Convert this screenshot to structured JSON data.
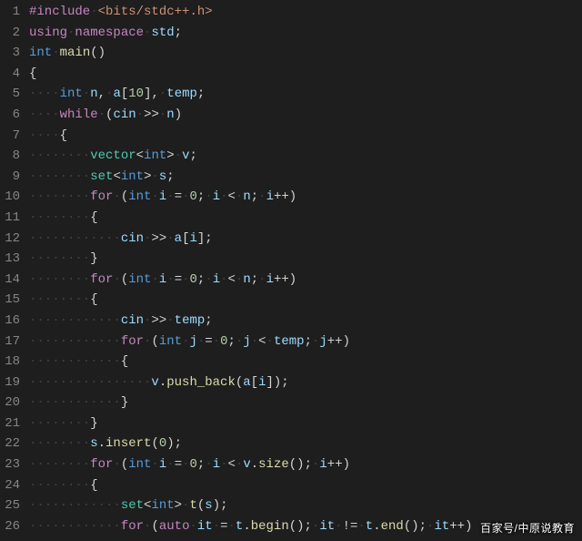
{
  "editor": {
    "line_count": 26,
    "whitespace_glyph": "·",
    "lines": [
      {
        "n": 1,
        "tokens": [
          [
            "pre",
            "#include"
          ],
          [
            "ws",
            "·"
          ],
          [
            "str",
            "<bits/stdc++.h>"
          ]
        ]
      },
      {
        "n": 2,
        "tokens": [
          [
            "kw",
            "using"
          ],
          [
            "ws",
            "·"
          ],
          [
            "kw",
            "namespace"
          ],
          [
            "ws",
            "·"
          ],
          [
            "id",
            "std"
          ],
          [
            "pun",
            ";"
          ]
        ]
      },
      {
        "n": 3,
        "tokens": [
          [
            "type",
            "int"
          ],
          [
            "ws",
            "·"
          ],
          [
            "fn",
            "main"
          ],
          [
            "pun",
            "()"
          ]
        ]
      },
      {
        "n": 4,
        "tokens": [
          [
            "pun",
            "{"
          ]
        ]
      },
      {
        "n": 5,
        "tokens": [
          [
            "ws",
            "····"
          ],
          [
            "type",
            "int"
          ],
          [
            "ws",
            "·"
          ],
          [
            "id",
            "n"
          ],
          [
            "pun",
            ","
          ],
          [
            "ws",
            "·"
          ],
          [
            "id",
            "a"
          ],
          [
            "pun",
            "["
          ],
          [
            "num",
            "10"
          ],
          [
            "pun",
            "],"
          ],
          [
            "ws",
            "·"
          ],
          [
            "id",
            "temp"
          ],
          [
            "pun",
            ";"
          ]
        ]
      },
      {
        "n": 6,
        "tokens": [
          [
            "ws",
            "····"
          ],
          [
            "kw",
            "while"
          ],
          [
            "ws",
            "·"
          ],
          [
            "pun",
            "("
          ],
          [
            "id",
            "cin"
          ],
          [
            "ws",
            "·"
          ],
          [
            "op",
            ">>"
          ],
          [
            "ws",
            "·"
          ],
          [
            "id",
            "n"
          ],
          [
            "pun",
            ")"
          ]
        ]
      },
      {
        "n": 7,
        "tokens": [
          [
            "ws",
            "····"
          ],
          [
            "pun",
            "{"
          ]
        ]
      },
      {
        "n": 8,
        "tokens": [
          [
            "ws",
            "········"
          ],
          [
            "cls",
            "vector"
          ],
          [
            "pun",
            "<"
          ],
          [
            "type",
            "int"
          ],
          [
            "pun",
            ">"
          ],
          [
            "ws",
            "·"
          ],
          [
            "id",
            "v"
          ],
          [
            "pun",
            ";"
          ]
        ]
      },
      {
        "n": 9,
        "tokens": [
          [
            "ws",
            "········"
          ],
          [
            "cls",
            "set"
          ],
          [
            "pun",
            "<"
          ],
          [
            "type",
            "int"
          ],
          [
            "pun",
            ">"
          ],
          [
            "ws",
            "·"
          ],
          [
            "id",
            "s"
          ],
          [
            "pun",
            ";"
          ]
        ]
      },
      {
        "n": 10,
        "tokens": [
          [
            "ws",
            "········"
          ],
          [
            "kw",
            "for"
          ],
          [
            "ws",
            "·"
          ],
          [
            "pun",
            "("
          ],
          [
            "type",
            "int"
          ],
          [
            "ws",
            "·"
          ],
          [
            "id",
            "i"
          ],
          [
            "ws",
            "·"
          ],
          [
            "op",
            "="
          ],
          [
            "ws",
            "·"
          ],
          [
            "num",
            "0"
          ],
          [
            "pun",
            ";"
          ],
          [
            "ws",
            "·"
          ],
          [
            "id",
            "i"
          ],
          [
            "ws",
            "·"
          ],
          [
            "op",
            "<"
          ],
          [
            "ws",
            "·"
          ],
          [
            "id",
            "n"
          ],
          [
            "pun",
            ";"
          ],
          [
            "ws",
            "·"
          ],
          [
            "id",
            "i"
          ],
          [
            "op",
            "++"
          ],
          [
            "pun",
            ")"
          ]
        ]
      },
      {
        "n": 11,
        "tokens": [
          [
            "ws",
            "········"
          ],
          [
            "pun",
            "{"
          ]
        ]
      },
      {
        "n": 12,
        "tokens": [
          [
            "ws",
            "············"
          ],
          [
            "id",
            "cin"
          ],
          [
            "ws",
            "·"
          ],
          [
            "op",
            ">>"
          ],
          [
            "ws",
            "·"
          ],
          [
            "id",
            "a"
          ],
          [
            "pun",
            "["
          ],
          [
            "id",
            "i"
          ],
          [
            "pun",
            "];"
          ]
        ]
      },
      {
        "n": 13,
        "tokens": [
          [
            "ws",
            "········"
          ],
          [
            "pun",
            "}"
          ]
        ]
      },
      {
        "n": 14,
        "tokens": [
          [
            "ws",
            "········"
          ],
          [
            "kw",
            "for"
          ],
          [
            "ws",
            "·"
          ],
          [
            "pun",
            "("
          ],
          [
            "type",
            "int"
          ],
          [
            "ws",
            "·"
          ],
          [
            "id",
            "i"
          ],
          [
            "ws",
            "·"
          ],
          [
            "op",
            "="
          ],
          [
            "ws",
            "·"
          ],
          [
            "num",
            "0"
          ],
          [
            "pun",
            ";"
          ],
          [
            "ws",
            "·"
          ],
          [
            "id",
            "i"
          ],
          [
            "ws",
            "·"
          ],
          [
            "op",
            "<"
          ],
          [
            "ws",
            "·"
          ],
          [
            "id",
            "n"
          ],
          [
            "pun",
            ";"
          ],
          [
            "ws",
            "·"
          ],
          [
            "id",
            "i"
          ],
          [
            "op",
            "++"
          ],
          [
            "pun",
            ")"
          ]
        ]
      },
      {
        "n": 15,
        "tokens": [
          [
            "ws",
            "········"
          ],
          [
            "pun",
            "{"
          ]
        ]
      },
      {
        "n": 16,
        "tokens": [
          [
            "ws",
            "············"
          ],
          [
            "id",
            "cin"
          ],
          [
            "ws",
            "·"
          ],
          [
            "op",
            ">>"
          ],
          [
            "ws",
            "·"
          ],
          [
            "id",
            "temp"
          ],
          [
            "pun",
            ";"
          ]
        ]
      },
      {
        "n": 17,
        "tokens": [
          [
            "ws",
            "············"
          ],
          [
            "kw",
            "for"
          ],
          [
            "ws",
            "·"
          ],
          [
            "pun",
            "("
          ],
          [
            "type",
            "int"
          ],
          [
            "ws",
            "·"
          ],
          [
            "id",
            "j"
          ],
          [
            "ws",
            "·"
          ],
          [
            "op",
            "="
          ],
          [
            "ws",
            "·"
          ],
          [
            "num",
            "0"
          ],
          [
            "pun",
            ";"
          ],
          [
            "ws",
            "·"
          ],
          [
            "id",
            "j"
          ],
          [
            "ws",
            "·"
          ],
          [
            "op",
            "<"
          ],
          [
            "ws",
            "·"
          ],
          [
            "id",
            "temp"
          ],
          [
            "pun",
            ";"
          ],
          [
            "ws",
            "·"
          ],
          [
            "id",
            "j"
          ],
          [
            "op",
            "++"
          ],
          [
            "pun",
            ")"
          ]
        ]
      },
      {
        "n": 18,
        "tokens": [
          [
            "ws",
            "············"
          ],
          [
            "pun",
            "{"
          ]
        ]
      },
      {
        "n": 19,
        "tokens": [
          [
            "ws",
            "················"
          ],
          [
            "id",
            "v"
          ],
          [
            "pun",
            "."
          ],
          [
            "fn",
            "push_back"
          ],
          [
            "pun",
            "("
          ],
          [
            "id",
            "a"
          ],
          [
            "pun",
            "["
          ],
          [
            "id",
            "i"
          ],
          [
            "pun",
            "]);"
          ]
        ]
      },
      {
        "n": 20,
        "tokens": [
          [
            "ws",
            "············"
          ],
          [
            "pun",
            "}"
          ]
        ]
      },
      {
        "n": 21,
        "tokens": [
          [
            "ws",
            "········"
          ],
          [
            "pun",
            "}"
          ]
        ]
      },
      {
        "n": 22,
        "tokens": [
          [
            "ws",
            "········"
          ],
          [
            "id",
            "s"
          ],
          [
            "pun",
            "."
          ],
          [
            "fn",
            "insert"
          ],
          [
            "pun",
            "("
          ],
          [
            "num",
            "0"
          ],
          [
            "pun",
            ");"
          ]
        ]
      },
      {
        "n": 23,
        "tokens": [
          [
            "ws",
            "········"
          ],
          [
            "kw",
            "for"
          ],
          [
            "ws",
            "·"
          ],
          [
            "pun",
            "("
          ],
          [
            "type",
            "int"
          ],
          [
            "ws",
            "·"
          ],
          [
            "id",
            "i"
          ],
          [
            "ws",
            "·"
          ],
          [
            "op",
            "="
          ],
          [
            "ws",
            "·"
          ],
          [
            "num",
            "0"
          ],
          [
            "pun",
            ";"
          ],
          [
            "ws",
            "·"
          ],
          [
            "id",
            "i"
          ],
          [
            "ws",
            "·"
          ],
          [
            "op",
            "<"
          ],
          [
            "ws",
            "·"
          ],
          [
            "id",
            "v"
          ],
          [
            "pun",
            "."
          ],
          [
            "fn",
            "size"
          ],
          [
            "pun",
            "();"
          ],
          [
            "ws",
            "·"
          ],
          [
            "id",
            "i"
          ],
          [
            "op",
            "++"
          ],
          [
            "pun",
            ")"
          ]
        ]
      },
      {
        "n": 24,
        "tokens": [
          [
            "ws",
            "········"
          ],
          [
            "pun",
            "{"
          ]
        ]
      },
      {
        "n": 25,
        "tokens": [
          [
            "ws",
            "············"
          ],
          [
            "cls",
            "set"
          ],
          [
            "pun",
            "<"
          ],
          [
            "type",
            "int"
          ],
          [
            "pun",
            ">"
          ],
          [
            "ws",
            "·"
          ],
          [
            "fn",
            "t"
          ],
          [
            "pun",
            "("
          ],
          [
            "id",
            "s"
          ],
          [
            "pun",
            ");"
          ]
        ]
      },
      {
        "n": 26,
        "tokens": [
          [
            "ws",
            "············"
          ],
          [
            "kw",
            "for"
          ],
          [
            "ws",
            "·"
          ],
          [
            "pun",
            "("
          ],
          [
            "kw",
            "auto"
          ],
          [
            "ws",
            "·"
          ],
          [
            "id",
            "it"
          ],
          [
            "ws",
            "·"
          ],
          [
            "op",
            "="
          ],
          [
            "ws",
            "·"
          ],
          [
            "id",
            "t"
          ],
          [
            "pun",
            "."
          ],
          [
            "fn",
            "begin"
          ],
          [
            "pun",
            "();"
          ],
          [
            "ws",
            "·"
          ],
          [
            "id",
            "it"
          ],
          [
            "ws",
            "·"
          ],
          [
            "op",
            "!="
          ],
          [
            "ws",
            "·"
          ],
          [
            "id",
            "t"
          ],
          [
            "pun",
            "."
          ],
          [
            "fn",
            "end"
          ],
          [
            "pun",
            "();"
          ],
          [
            "ws",
            "·"
          ],
          [
            "id",
            "it"
          ],
          [
            "op",
            "++"
          ],
          [
            "pun",
            ")"
          ]
        ]
      }
    ]
  },
  "watermark": "百家号/中原说教育"
}
